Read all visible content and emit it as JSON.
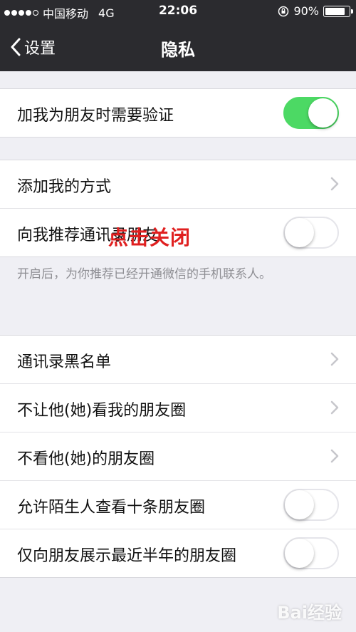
{
  "status_bar": {
    "carrier": "中国移动",
    "network": "4G",
    "time": "22:06",
    "battery": "90%",
    "battery_level": 0.9,
    "signal_bars_filled": 4,
    "signal_bars_total": 5
  },
  "nav": {
    "back_label": "设置",
    "title": "隐私"
  },
  "sections": {
    "verify": {
      "label": "加我为朋友时需要验证",
      "toggle_on": true
    },
    "contacts": {
      "add_method_label": "添加我的方式",
      "recommend_label": "向我推荐通讯录朋友",
      "recommend_on": false,
      "note": "开启后，为你推荐已经开通微信的手机联系人。"
    },
    "moments": {
      "blacklist_label": "通讯录黑名单",
      "hide_mine_label": "不让他(她)看我的朋友圈",
      "hide_theirs_label": "不看他(她)的朋友圈",
      "stranger_label": "允许陌生人查看十条朋友圈",
      "stranger_on": false,
      "half_year_label": "仅向朋友展示最近半年的朋友圈",
      "half_year_on": false
    }
  },
  "annotation": "点击关闭",
  "watermark": "Bai经验",
  "colors": {
    "nav_bg": "#2b2b2f",
    "toggle_on": "#4cd964",
    "annotation": "#e02020",
    "page_bg": "#efeff4"
  }
}
